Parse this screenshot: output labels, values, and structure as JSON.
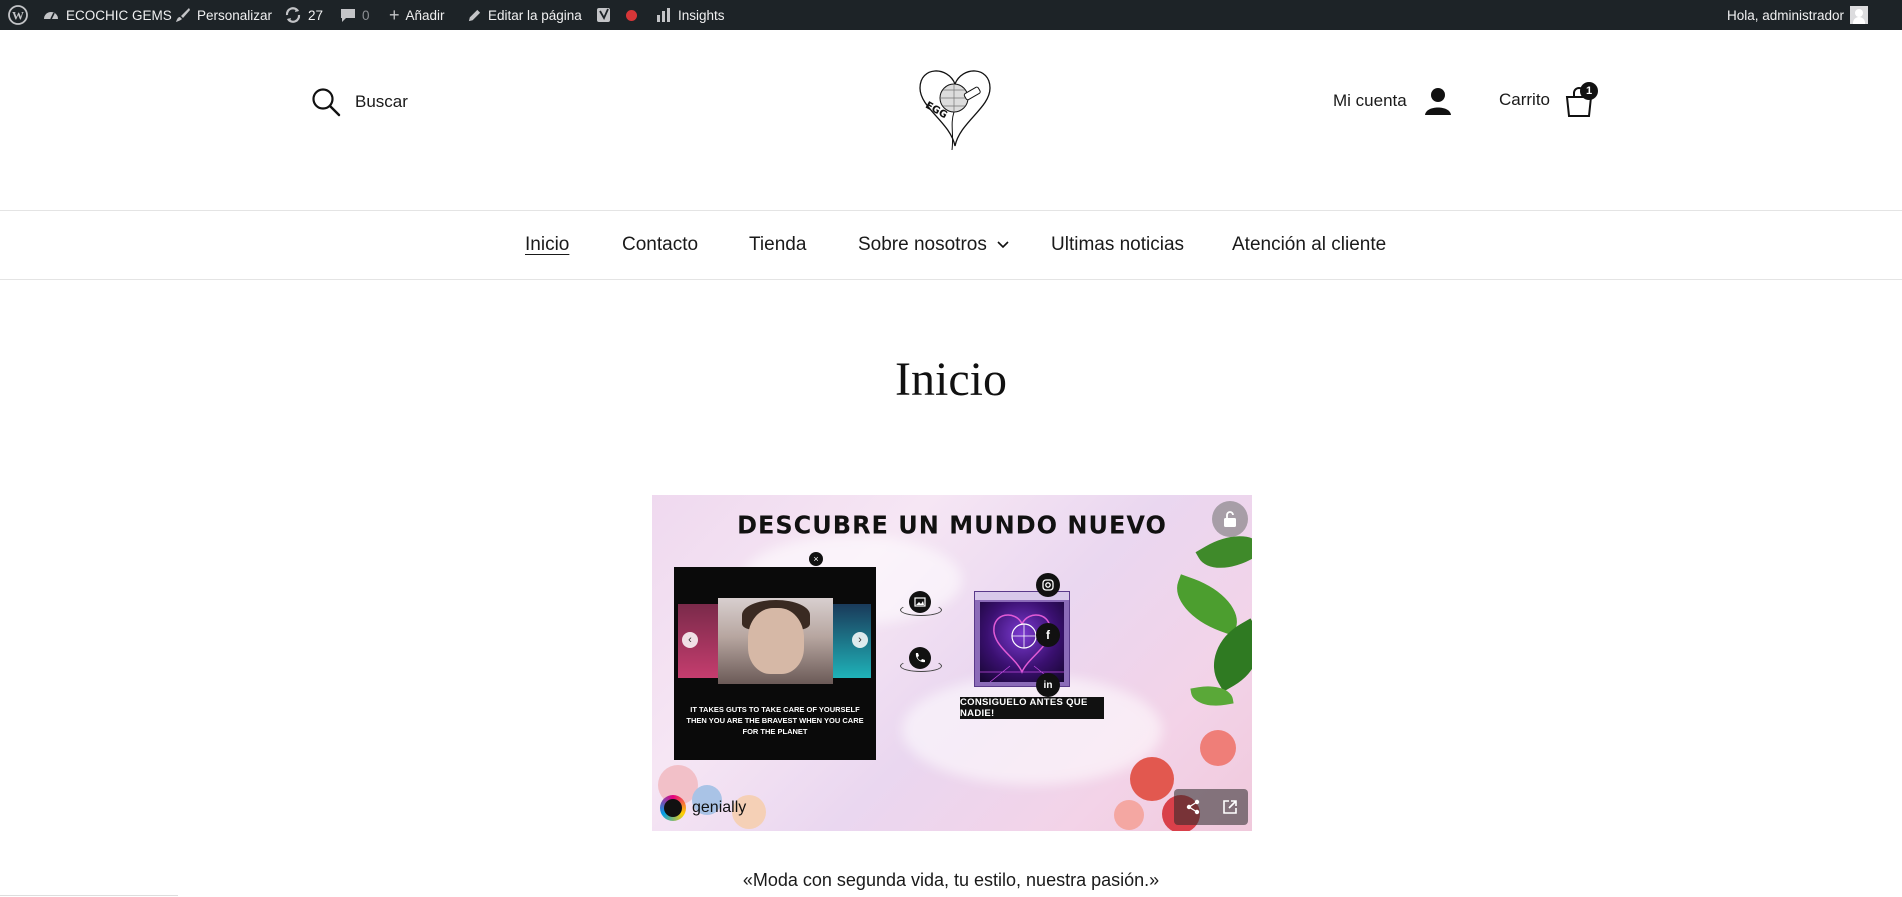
{
  "adminbar": {
    "site_name": "ECOCHIC GEMS",
    "customize": "Personalizar",
    "updates_count": "27",
    "comments_count": "0",
    "add_new": "Añadir",
    "edit_page": "Editar la página",
    "insights": "Insights",
    "greeting": "Hola, administrador",
    "status_dot_color": "#d63638"
  },
  "header": {
    "search_label": "Buscar",
    "account_label": "Mi cuenta",
    "cart_label": "Carrito",
    "cart_count": "1",
    "logo_letters": "EGG"
  },
  "nav": {
    "items": [
      {
        "label": "Inicio",
        "active": true
      },
      {
        "label": "Contacto"
      },
      {
        "label": "Tienda"
      },
      {
        "label": "Sobre nosotros",
        "has_dropdown": true
      },
      {
        "label": "Ultimas noticias"
      },
      {
        "label": "Atención al cliente"
      }
    ]
  },
  "page": {
    "title": "Inicio",
    "tagline": "«Moda con segunda vida, tu estilo, nuestra pasión.»"
  },
  "embed": {
    "headline": "DESCUBRE UN MUNDO NUEVO",
    "card_quote": "IT TAKES GUTS TO TAKE CARE OF YOURSELF THEN YOU ARE THE BRAVEST WHEN YOU CARE FOR THE PLANET",
    "banner": "CONSIGUELO ANTES QUE NADIE!",
    "brand": "genially",
    "close_symbol": "×",
    "prev_arrow": "‹",
    "next_arrow": "›",
    "social_icons": [
      "instagram-icon",
      "facebook-icon",
      "linkedin-icon"
    ]
  }
}
